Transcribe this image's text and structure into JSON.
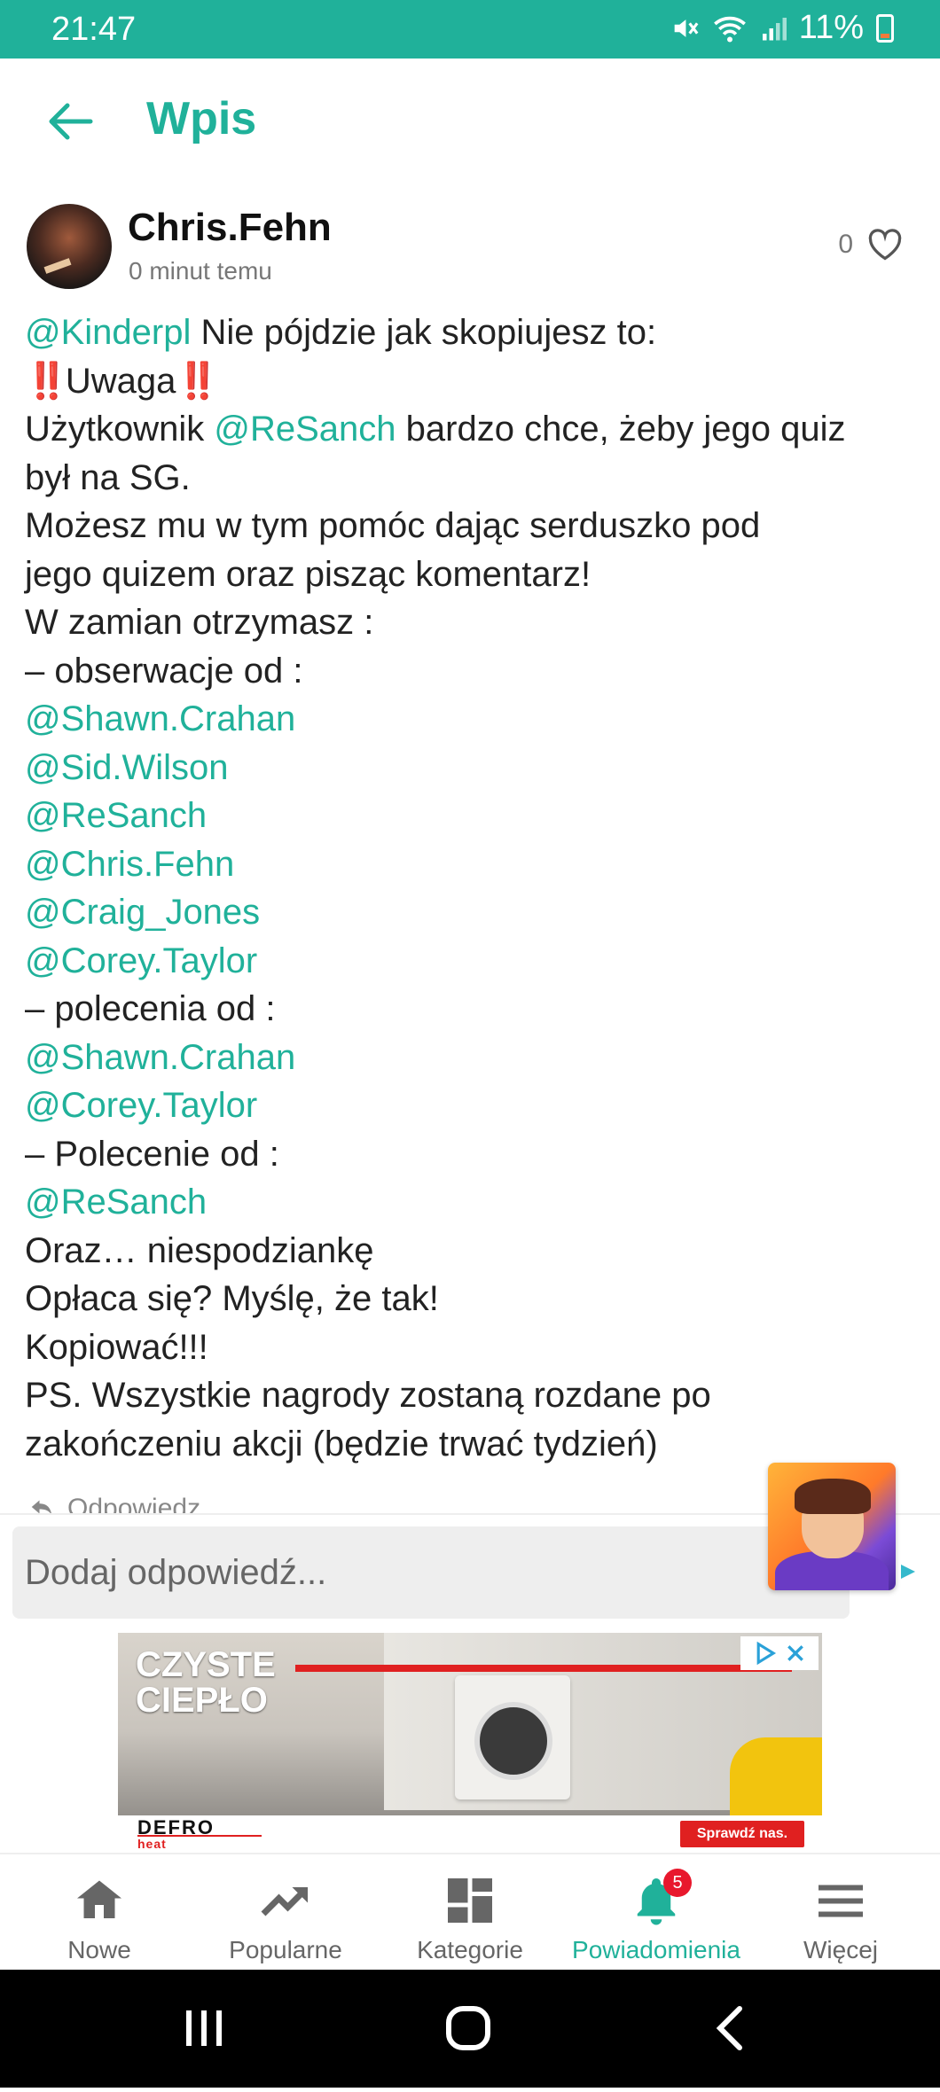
{
  "status_bar": {
    "time": "21:47",
    "battery": "11%"
  },
  "header": {
    "title": "Wpis"
  },
  "post": {
    "username": "Chris.Fehn",
    "time_ago": "0 minut temu",
    "like_count": "0",
    "lines": [
      [
        {
          "t": "@Kinderpl",
          "m": true
        },
        {
          "t": " Nie pójdzie jak skopiujesz to:"
        }
      ],
      [
        {
          "t": "‼️",
          "e": true
        },
        {
          "t": "Uwaga"
        },
        {
          "t": "‼️",
          "e": true
        }
      ],
      [
        {
          "t": "Użytkownik "
        },
        {
          "t": "@ReSanch",
          "m": true
        },
        {
          "t": " bardzo chce, żeby jego quiz"
        }
      ],
      [
        {
          "t": "był na SG."
        }
      ],
      [
        {
          "t": "Możesz mu w tym pomóc dając serduszko pod"
        }
      ],
      [
        {
          "t": "jego quizem oraz pisząc komentarz!"
        }
      ],
      [
        {
          "t": "W zamian otrzymasz :"
        }
      ],
      [
        {
          "t": "– obserwacje od :"
        }
      ],
      [
        {
          "t": "@Shawn.Crahan",
          "m": true
        }
      ],
      [
        {
          "t": "@Sid.Wilson",
          "m": true
        }
      ],
      [
        {
          "t": "@ReSanch",
          "m": true
        }
      ],
      [
        {
          "t": "@Chris.Fehn",
          "m": true
        }
      ],
      [
        {
          "t": "@Craig_Jones",
          "m": true
        }
      ],
      [
        {
          "t": "@Corey.Taylor",
          "m": true
        }
      ],
      [
        {
          "t": "– polecenia od :"
        }
      ],
      [
        {
          "t": "@Shawn.Crahan",
          "m": true
        }
      ],
      [
        {
          "t": "@Corey.Taylor",
          "m": true
        }
      ],
      [
        {
          "t": "– Polecenie od :"
        }
      ],
      [
        {
          "t": "@ReSanch",
          "m": true
        }
      ],
      [
        {
          "t": "Oraz… niespodziankę"
        }
      ],
      [
        {
          "t": "Opłaca się? Myślę, że tak!"
        }
      ],
      [
        {
          "t": "Kopiować!!!"
        }
      ],
      [
        {
          "t": "PS. Wszystkie nagrody zostaną rozdane po"
        }
      ],
      [
        {
          "t": "zakończeniu akcji (będzie trwać tydzień)"
        }
      ]
    ],
    "reply_label": "Odpowiedz"
  },
  "reply_input": {
    "placeholder": "Dodaj odpowiedź..."
  },
  "ad": {
    "headline_1": "CZYSTE",
    "headline_2": "CIEPŁO",
    "brand": "DEFRO",
    "brand_sub": "heat",
    "cta": "Sprawdź nas."
  },
  "bottom_nav": [
    {
      "label": "Nowe",
      "icon": "home-icon"
    },
    {
      "label": "Popularne",
      "icon": "trending-icon"
    },
    {
      "label": "Kategorie",
      "icon": "dashboard-icon"
    },
    {
      "label": "Powiadomienia",
      "icon": "bell-icon",
      "badge": "5",
      "active": true
    },
    {
      "label": "Więcej",
      "icon": "menu-icon"
    }
  ],
  "colors": {
    "accent": "#20b19a",
    "badge": "#e8182d"
  }
}
